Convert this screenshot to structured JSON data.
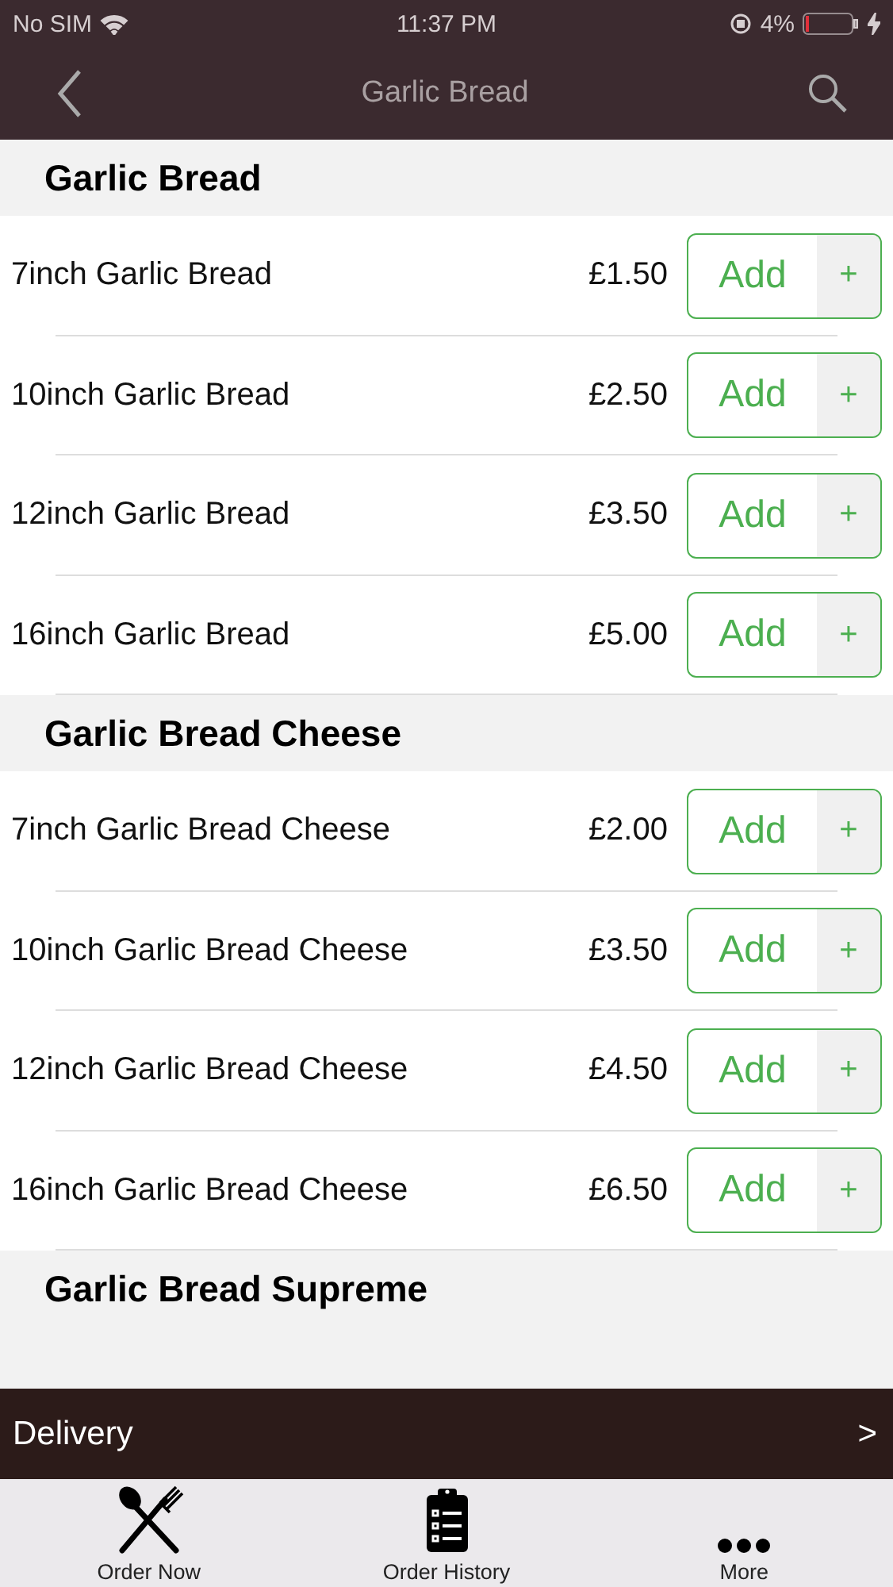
{
  "status_bar": {
    "carrier": "No SIM",
    "time": "11:37 PM",
    "battery": "4%"
  },
  "nav": {
    "title": "Garlic Bread"
  },
  "sections": [
    {
      "title": "Garlic Bread",
      "items": [
        {
          "name": "7inch Garlic Bread",
          "price": "£1.50",
          "button": "Add",
          "plus": "+"
        },
        {
          "name": "10inch Garlic Bread",
          "price": "£2.50",
          "button": "Add",
          "plus": "+"
        },
        {
          "name": "12inch Garlic Bread",
          "price": "£3.50",
          "button": "Add",
          "plus": "+"
        },
        {
          "name": "16inch Garlic Bread",
          "price": "£5.00",
          "button": "Add",
          "plus": "+"
        }
      ]
    },
    {
      "title": "Garlic Bread Cheese",
      "items": [
        {
          "name": "7inch Garlic Bread Cheese",
          "price": "£2.00",
          "button": "Add",
          "plus": "+"
        },
        {
          "name": "10inch Garlic Bread Cheese",
          "price": "£3.50",
          "button": "Add",
          "plus": "+"
        },
        {
          "name": "12inch Garlic Bread Cheese",
          "price": "£4.50",
          "button": "Add",
          "plus": "+"
        },
        {
          "name": "16inch Garlic Bread Cheese",
          "price": "£6.50",
          "button": "Add",
          "plus": "+"
        }
      ]
    },
    {
      "title": "Garlic Bread Supreme"
    }
  ],
  "delivery": {
    "label": "Delivery",
    "arrow": ">"
  },
  "tabs": [
    {
      "label": "Order Now",
      "kind": "cutlery"
    },
    {
      "label": "Order History",
      "kind": "clipboard"
    },
    {
      "label": "More",
      "kind": "dots"
    }
  ]
}
